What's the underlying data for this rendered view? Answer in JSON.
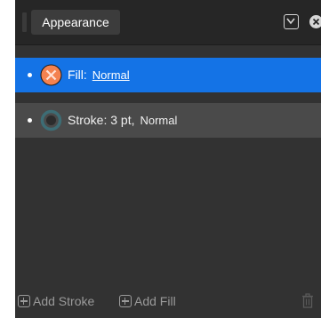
{
  "panel": {
    "tab_label": "Appearance",
    "menu_icon": "chevron-down-icon",
    "close_icon": "close-icon"
  },
  "items": [
    {
      "type_label": "Fill:",
      "blend_mode": "Normal",
      "selected": true,
      "swatch_icon": "no-fill-swatch-icon"
    },
    {
      "type_label": "Stroke: 3 pt,",
      "blend_mode": "Normal",
      "selected": false,
      "swatch_icon": "stroke-swatch-icon"
    }
  ],
  "footer": {
    "add_stroke_label": "Add Stroke",
    "add_fill_label": "Add Fill",
    "delete_icon": "trash-icon"
  },
  "colors": {
    "panel_bg": "#323232",
    "header_bg": "#262626",
    "selected_row": "#1473e6",
    "unselected_row": "#4a4a4a",
    "swatch_orange": "#f4824f"
  }
}
